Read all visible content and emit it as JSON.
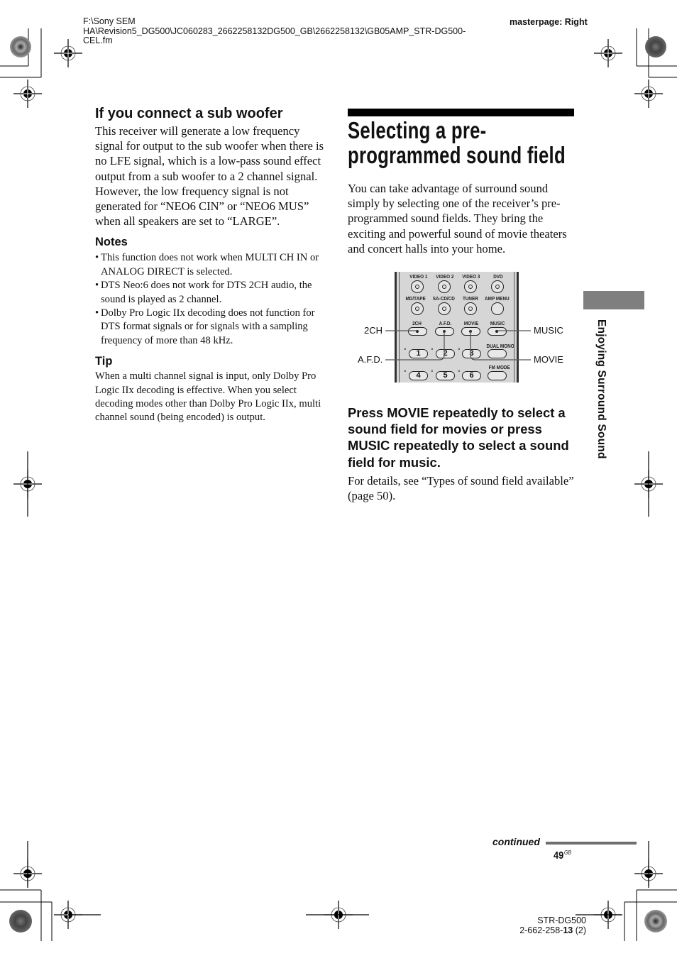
{
  "header": {
    "file_path_lines": [
      "F:\\Sony SEM",
      "HA\\Revision5_DG500\\JC060283_2662258132DG500_GB\\2662258132\\GB05AMP_STR-DG500-",
      "CEL.fm"
    ],
    "masterpage": "masterpage: Right"
  },
  "left_column": {
    "section_heading": "If you connect a sub woofer",
    "section_body": "This receiver will generate a low frequency signal for output to the sub woofer when there is no LFE signal, which is a low-pass sound effect output from a sub woofer to a 2 channel signal. However, the low frequency signal is not generated for “NEO6 CIN” or “NEO6 MUS” when all speakers are set to “LARGE”.",
    "notes_heading": "Notes",
    "notes": [
      "This function does not work when MULTI CH IN or ANALOG DIRECT is selected.",
      "DTS Neo:6 does not work for DTS 2CH audio, the sound is played as 2 channel.",
      "Dolby Pro Logic IIx decoding does not function for DTS format signals or for signals with a sampling frequency of more than 48 kHz."
    ],
    "tip_heading": "Tip",
    "tip_body": "When a multi channel signal is input, only Dolby Pro Logic IIx decoding is effective. When you select decoding modes other than Dolby Pro Logic IIx, multi channel sound (being encoded) is output."
  },
  "right_column": {
    "page_title_lines": [
      "Selecting a pre-",
      "programmed sound field"
    ],
    "intro": "You can take advantage of surround sound simply by selecting one of the receiver’s pre-programmed sound fields. They bring the exciting and powerful sound of movie theaters and concert halls into your home.",
    "step_heading": "Press MOVIE repeatedly to select a sound field for movies or press MUSIC repeatedly to select a sound field for music.",
    "step_body": "For details, see “Types of sound field available” (page 50)."
  },
  "remote": {
    "row1_labels": [
      "VIDEO 1",
      "VIDEO 2",
      "VIDEO 3",
      "DVD"
    ],
    "row2_labels": [
      "MD/TAPE",
      "SA-CD/CD",
      "TUNER",
      "AMP MENU"
    ],
    "row3_labels": [
      "2CH",
      "A.F.D.",
      "MOVIE",
      "MUSIC"
    ],
    "numbers_row1": [
      "1",
      "2",
      "3"
    ],
    "numbers_row2": [
      "4",
      "5",
      "6"
    ],
    "dual_mono": "DUAL MONO",
    "fm_mode": "FM MODE",
    "degree_mark": "°",
    "callouts": {
      "two_ch": "2CH",
      "afd": "A.F.D.",
      "music": "MUSIC",
      "movie": "MOVIE"
    }
  },
  "side_tab": {
    "label": "Enjoying Surround Sound",
    "color": "#7f7f7f"
  },
  "footer": {
    "continued": "continued",
    "page_number": "49",
    "page_suffix": "GB",
    "model": "STR-DG500",
    "code_prefix": "2-662-258-",
    "code_bold": "13",
    "code_suffix": " (2)"
  }
}
